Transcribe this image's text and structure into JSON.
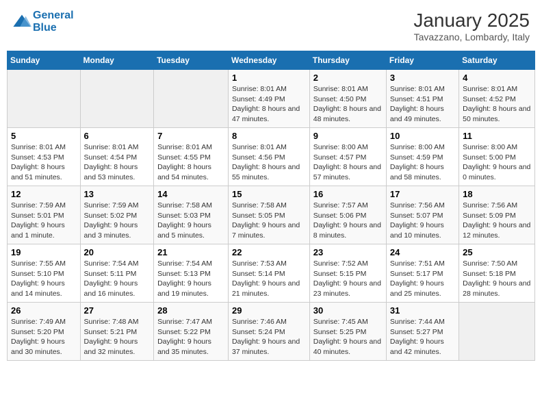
{
  "header": {
    "logo_line1": "General",
    "logo_line2": "Blue",
    "month": "January 2025",
    "location": "Tavazzano, Lombardy, Italy"
  },
  "days_of_week": [
    "Sunday",
    "Monday",
    "Tuesday",
    "Wednesday",
    "Thursday",
    "Friday",
    "Saturday"
  ],
  "weeks": [
    [
      {
        "day": "",
        "info": ""
      },
      {
        "day": "",
        "info": ""
      },
      {
        "day": "",
        "info": ""
      },
      {
        "day": "1",
        "info": "Sunrise: 8:01 AM\nSunset: 4:49 PM\nDaylight: 8 hours and 47 minutes."
      },
      {
        "day": "2",
        "info": "Sunrise: 8:01 AM\nSunset: 4:50 PM\nDaylight: 8 hours and 48 minutes."
      },
      {
        "day": "3",
        "info": "Sunrise: 8:01 AM\nSunset: 4:51 PM\nDaylight: 8 hours and 49 minutes."
      },
      {
        "day": "4",
        "info": "Sunrise: 8:01 AM\nSunset: 4:52 PM\nDaylight: 8 hours and 50 minutes."
      }
    ],
    [
      {
        "day": "5",
        "info": "Sunrise: 8:01 AM\nSunset: 4:53 PM\nDaylight: 8 hours and 51 minutes."
      },
      {
        "day": "6",
        "info": "Sunrise: 8:01 AM\nSunset: 4:54 PM\nDaylight: 8 hours and 53 minutes."
      },
      {
        "day": "7",
        "info": "Sunrise: 8:01 AM\nSunset: 4:55 PM\nDaylight: 8 hours and 54 minutes."
      },
      {
        "day": "8",
        "info": "Sunrise: 8:01 AM\nSunset: 4:56 PM\nDaylight: 8 hours and 55 minutes."
      },
      {
        "day": "9",
        "info": "Sunrise: 8:00 AM\nSunset: 4:57 PM\nDaylight: 8 hours and 57 minutes."
      },
      {
        "day": "10",
        "info": "Sunrise: 8:00 AM\nSunset: 4:59 PM\nDaylight: 8 hours and 58 minutes."
      },
      {
        "day": "11",
        "info": "Sunrise: 8:00 AM\nSunset: 5:00 PM\nDaylight: 9 hours and 0 minutes."
      }
    ],
    [
      {
        "day": "12",
        "info": "Sunrise: 7:59 AM\nSunset: 5:01 PM\nDaylight: 9 hours and 1 minute."
      },
      {
        "day": "13",
        "info": "Sunrise: 7:59 AM\nSunset: 5:02 PM\nDaylight: 9 hours and 3 minutes."
      },
      {
        "day": "14",
        "info": "Sunrise: 7:58 AM\nSunset: 5:03 PM\nDaylight: 9 hours and 5 minutes."
      },
      {
        "day": "15",
        "info": "Sunrise: 7:58 AM\nSunset: 5:05 PM\nDaylight: 9 hours and 7 minutes."
      },
      {
        "day": "16",
        "info": "Sunrise: 7:57 AM\nSunset: 5:06 PM\nDaylight: 9 hours and 8 minutes."
      },
      {
        "day": "17",
        "info": "Sunrise: 7:56 AM\nSunset: 5:07 PM\nDaylight: 9 hours and 10 minutes."
      },
      {
        "day": "18",
        "info": "Sunrise: 7:56 AM\nSunset: 5:09 PM\nDaylight: 9 hours and 12 minutes."
      }
    ],
    [
      {
        "day": "19",
        "info": "Sunrise: 7:55 AM\nSunset: 5:10 PM\nDaylight: 9 hours and 14 minutes."
      },
      {
        "day": "20",
        "info": "Sunrise: 7:54 AM\nSunset: 5:11 PM\nDaylight: 9 hours and 16 minutes."
      },
      {
        "day": "21",
        "info": "Sunrise: 7:54 AM\nSunset: 5:13 PM\nDaylight: 9 hours and 19 minutes."
      },
      {
        "day": "22",
        "info": "Sunrise: 7:53 AM\nSunset: 5:14 PM\nDaylight: 9 hours and 21 minutes."
      },
      {
        "day": "23",
        "info": "Sunrise: 7:52 AM\nSunset: 5:15 PM\nDaylight: 9 hours and 23 minutes."
      },
      {
        "day": "24",
        "info": "Sunrise: 7:51 AM\nSunset: 5:17 PM\nDaylight: 9 hours and 25 minutes."
      },
      {
        "day": "25",
        "info": "Sunrise: 7:50 AM\nSunset: 5:18 PM\nDaylight: 9 hours and 28 minutes."
      }
    ],
    [
      {
        "day": "26",
        "info": "Sunrise: 7:49 AM\nSunset: 5:20 PM\nDaylight: 9 hours and 30 minutes."
      },
      {
        "day": "27",
        "info": "Sunrise: 7:48 AM\nSunset: 5:21 PM\nDaylight: 9 hours and 32 minutes."
      },
      {
        "day": "28",
        "info": "Sunrise: 7:47 AM\nSunset: 5:22 PM\nDaylight: 9 hours and 35 minutes."
      },
      {
        "day": "29",
        "info": "Sunrise: 7:46 AM\nSunset: 5:24 PM\nDaylight: 9 hours and 37 minutes."
      },
      {
        "day": "30",
        "info": "Sunrise: 7:45 AM\nSunset: 5:25 PM\nDaylight: 9 hours and 40 minutes."
      },
      {
        "day": "31",
        "info": "Sunrise: 7:44 AM\nSunset: 5:27 PM\nDaylight: 9 hours and 42 minutes."
      },
      {
        "day": "",
        "info": ""
      }
    ]
  ]
}
